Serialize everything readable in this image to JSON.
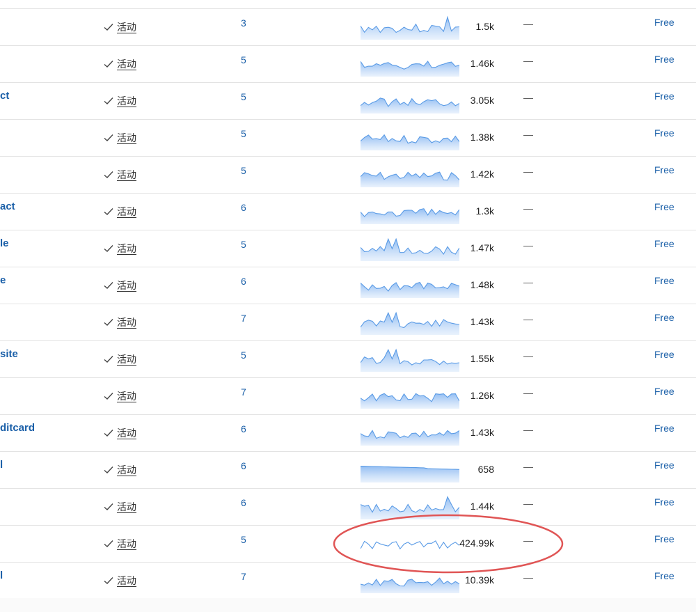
{
  "status_icon": "checkmark-icon",
  "annotation": {
    "shape": "ellipse",
    "color": "#e05555",
    "highlights_row": 14
  },
  "rows": [
    {
      "name": "",
      "status": "活动",
      "count": "3",
      "traffic": "1.5k",
      "dash": "—",
      "plan": "Free"
    },
    {
      "name": "",
      "status": "活动",
      "count": "5",
      "traffic": "1.46k",
      "dash": "—",
      "plan": "Free"
    },
    {
      "name": "ct",
      "status": "活动",
      "count": "5",
      "traffic": "3.05k",
      "dash": "—",
      "plan": "Free"
    },
    {
      "name": "",
      "status": "活动",
      "count": "5",
      "traffic": "1.38k",
      "dash": "—",
      "plan": "Free"
    },
    {
      "name": "",
      "status": "活动",
      "count": "5",
      "traffic": "1.42k",
      "dash": "—",
      "plan": "Free"
    },
    {
      "name": "act",
      "status": "活动",
      "count": "6",
      "traffic": "1.3k",
      "dash": "—",
      "plan": "Free"
    },
    {
      "name": "le",
      "status": "活动",
      "count": "5",
      "traffic": "1.47k",
      "dash": "—",
      "plan": "Free"
    },
    {
      "name": "e",
      "status": "活动",
      "count": "6",
      "traffic": "1.48k",
      "dash": "—",
      "plan": "Free"
    },
    {
      "name": "",
      "status": "活动",
      "count": "7",
      "traffic": "1.43k",
      "dash": "—",
      "plan": "Free"
    },
    {
      "name": "site",
      "status": "活动",
      "count": "5",
      "traffic": "1.55k",
      "dash": "—",
      "plan": "Free"
    },
    {
      "name": "",
      "status": "活动",
      "count": "7",
      "traffic": "1.26k",
      "dash": "—",
      "plan": "Free"
    },
    {
      "name": "ditcard",
      "status": "活动",
      "count": "6",
      "traffic": "1.43k",
      "dash": "—",
      "plan": "Free"
    },
    {
      "name": "l",
      "status": "活动",
      "count": "6",
      "traffic": "658",
      "dash": "—",
      "plan": "Free"
    },
    {
      "name": "",
      "status": "活动",
      "count": "6",
      "traffic": "1.44k",
      "dash": "—",
      "plan": "Free"
    },
    {
      "name": "",
      "status": "活动",
      "count": "5",
      "traffic": "424.99k",
      "dash": "—",
      "plan": "Free"
    },
    {
      "name": "l",
      "status": "活动",
      "count": "7",
      "traffic": "10.39k",
      "dash": "—",
      "plan": "Free"
    }
  ]
}
